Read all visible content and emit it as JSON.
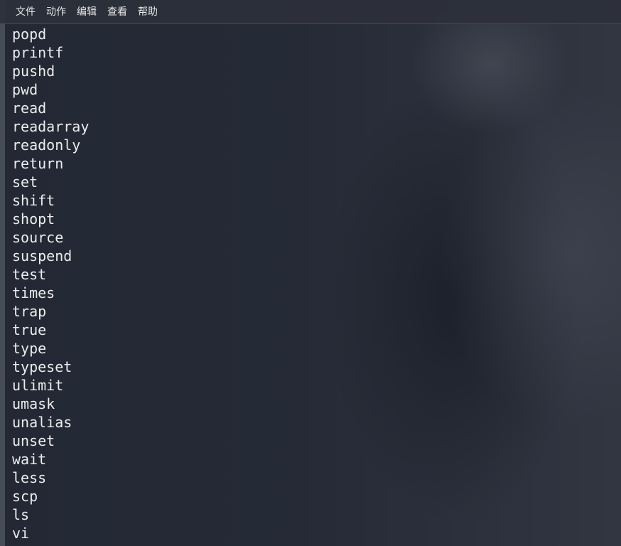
{
  "menubar": {
    "items": [
      "文件",
      "动作",
      "编辑",
      "查看",
      "帮助"
    ]
  },
  "terminal": {
    "lines": [
      "popd",
      "printf",
      "pushd",
      "pwd",
      "read",
      "readarray",
      "readonly",
      "return",
      "set",
      "shift",
      "shopt",
      "source",
      "suspend",
      "test",
      "times",
      "trap",
      "true",
      "type",
      "typeset",
      "ulimit",
      "umask",
      "unalias",
      "unset",
      "wait",
      "less",
      "scp",
      "ls",
      "vi"
    ]
  }
}
